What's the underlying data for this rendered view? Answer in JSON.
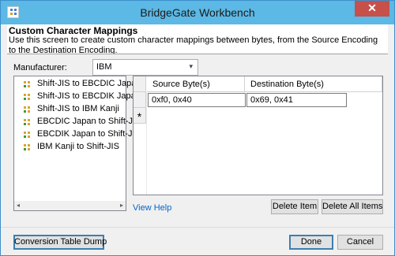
{
  "window": {
    "title": "BridgeGate Workbench",
    "close_symbol": "✕"
  },
  "banner": {
    "title": "Custom Character Mappings",
    "description": "Use this screen to create custom character mappings between bytes, from the Source Encoding to the Destination Encoding."
  },
  "manufacturer": {
    "label": "Manufacturer:",
    "value": "IBM",
    "arrow": "▾"
  },
  "tree": {
    "items": [
      "Shift-JIS to EBCDIC Japan",
      "Shift-JIS to EBCDIK Japan",
      "Shift-JIS to IBM Kanji",
      "EBCDIC Japan to Shift-JIS",
      "EBCDIK Japan to Shift-JIS",
      "IBM Kanji to Shift-JIS"
    ],
    "scroll_left": "◂",
    "scroll_right": "▸"
  },
  "grid": {
    "columns": [
      "Source Byte(s)",
      "Destination Byte(s)"
    ],
    "rows": [
      [
        "0xf0, 0x40",
        "0x69, 0x41"
      ]
    ],
    "new_row_marker": "*"
  },
  "links": {
    "view_help": "View Help"
  },
  "buttons": {
    "delete_item": "Delete Item",
    "delete_all_items": "Delete All Items",
    "conversion_table_dump": "Conversion Table Dump",
    "done": "Done",
    "cancel": "Cancel"
  },
  "colors": {
    "titlebar": "#5cb8e4",
    "close_button": "#c7504a",
    "link": "#0066cc"
  }
}
